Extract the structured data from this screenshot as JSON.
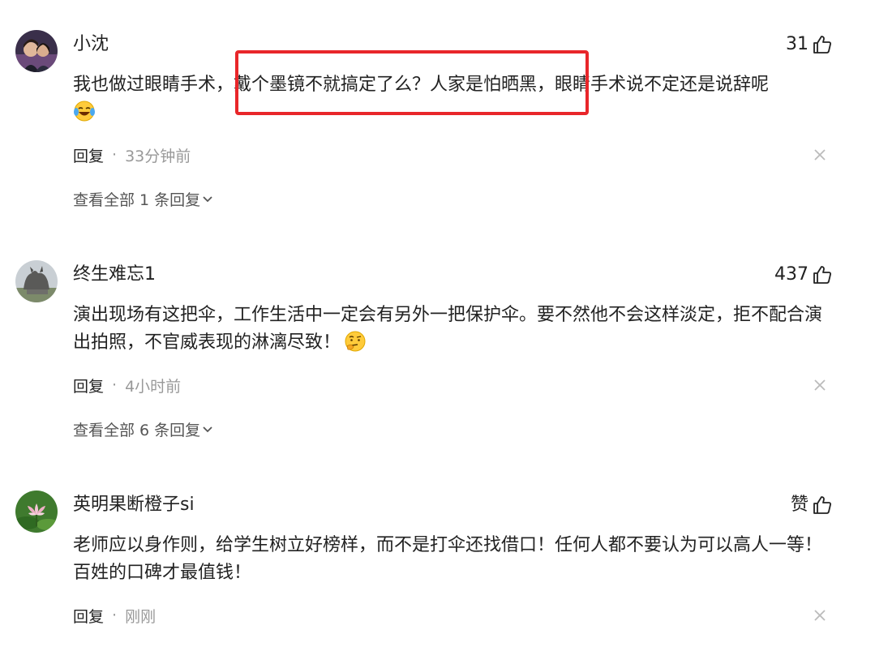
{
  "comments": [
    {
      "username": "小沈",
      "likes": "31",
      "text": "我也做过眼睛手术，戴个墨镜不就搞定了么？人家是怕晒黑，眼睛手术说不定还是说辞呢",
      "emoji": "laughing-crying-emoji",
      "reply_label": "回复",
      "separator": "·",
      "time": "33分钟前",
      "view_all": "查看全部 1 条回复"
    },
    {
      "username": "终生难忘1",
      "likes": "437",
      "text": "演出现场有这把伞，工作生活中一定会有另外一把保护伞。要不然他不会这样淡定，拒不配合演出拍照，不官威表现的淋漓尽致！",
      "emoji": "thinking-emoji",
      "reply_label": "回复",
      "separator": "·",
      "time": "4小时前",
      "view_all": "查看全部 6 条回复"
    },
    {
      "username": "英明果断橙子si",
      "likes": "赞",
      "text": "老师应以身作则，给学生树立好榜样，而不是打伞还找借口！任何人都不要认为可以高人一等！百姓的口碑才最值钱！",
      "reply_label": "回复",
      "separator": "·",
      "time": "刚刚"
    }
  ],
  "colors": {
    "highlight": "#e8262a",
    "muted": "#999999",
    "text": "#222222"
  }
}
